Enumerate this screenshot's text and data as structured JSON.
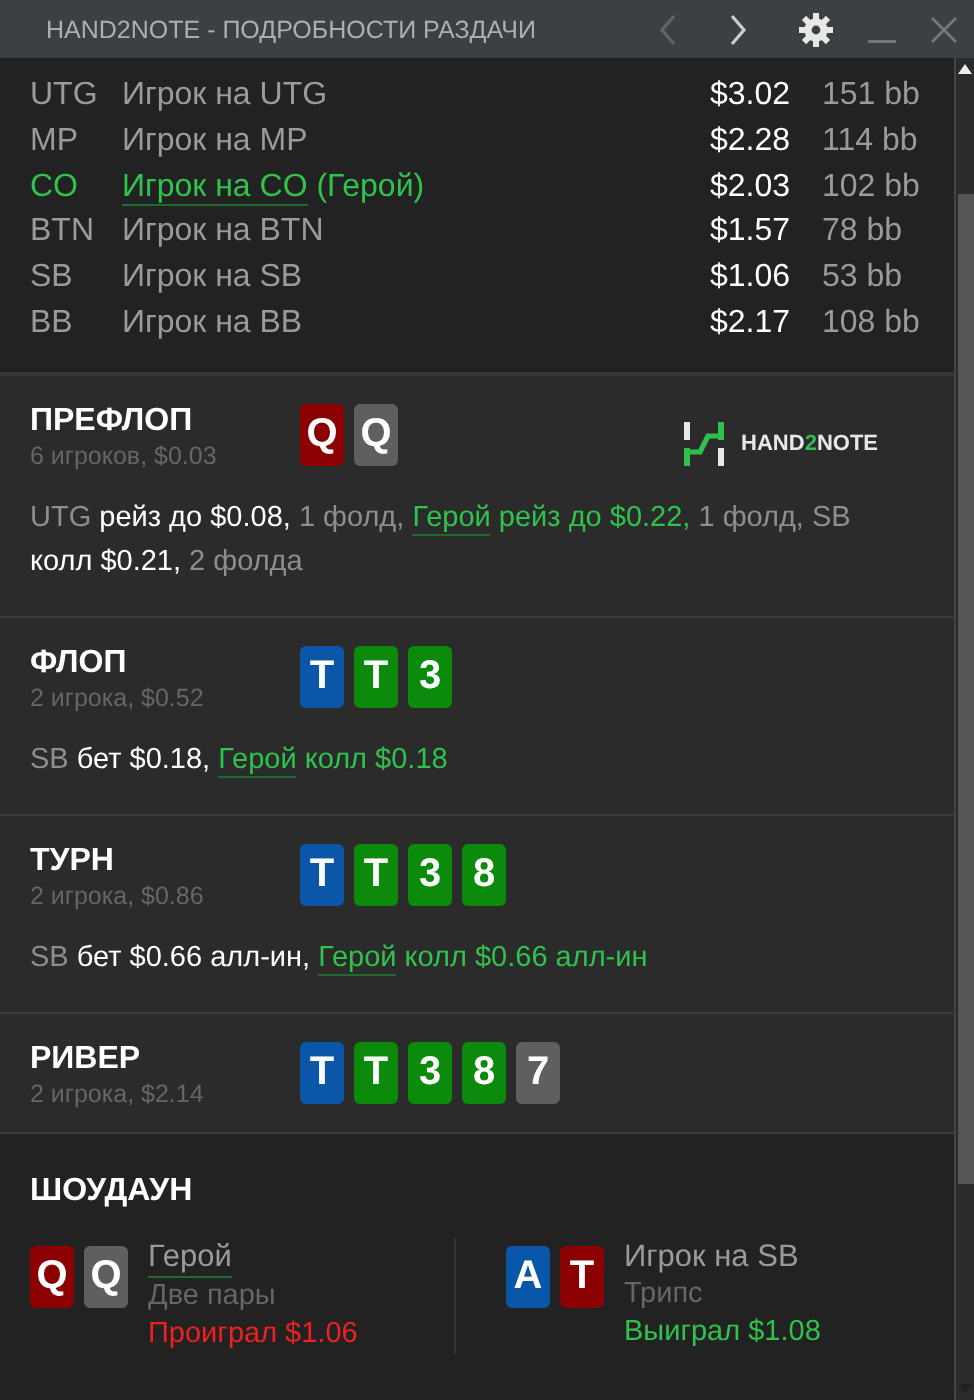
{
  "window": {
    "title": "HAND2NOTE - ПОДРОБНОСТИ РАЗДАЧИ",
    "prev_disabled": true,
    "next_disabled": false
  },
  "players": [
    {
      "position": "UTG",
      "name": "Игрок на UTG",
      "hero": false,
      "stack": "$3.02",
      "bb": "151 bb"
    },
    {
      "position": "MP",
      "name": "Игрок на MP",
      "hero": false,
      "stack": "$2.28",
      "bb": "114 bb"
    },
    {
      "position": "CO",
      "name": "Игрок на CO",
      "suffix": " (Герой)",
      "hero": true,
      "stack": "$2.03",
      "bb": "102 bb"
    },
    {
      "position": "BTN",
      "name": "Игрок на BTN",
      "hero": false,
      "stack": "$1.57",
      "bb": "78 bb"
    },
    {
      "position": "SB",
      "name": "Игрок на SB",
      "hero": false,
      "stack": "$1.06",
      "bb": "53 bb"
    },
    {
      "position": "BB",
      "name": "Игрок на BB",
      "hero": false,
      "stack": "$2.17",
      "bb": "108 bb"
    }
  ],
  "logo": [
    {
      "text": "HAND",
      "accent": false
    },
    {
      "text": "2",
      "accent": true
    },
    {
      "text": "NOTE",
      "accent": false
    }
  ],
  "streets": [
    {
      "title": "ПРЕФЛОП",
      "subtitle": "6 игроков, $0.03",
      "show_logo": true,
      "cards": [
        {
          "rank": "Q",
          "color": "#8b0000"
        },
        {
          "rank": "Q",
          "color": "#5f5f5f"
        }
      ],
      "actions": [
        {
          "kind": "pos",
          "text": "UTG "
        },
        {
          "kind": "act",
          "text": "рейз до $0.08, "
        },
        {
          "kind": "fold",
          "text": "1 фолд, "
        },
        {
          "kind": "hero",
          "text": "Герой"
        },
        {
          "kind": "hero_act",
          "text": " рейз до $0.22, "
        },
        {
          "kind": "fold",
          "text": "1 фолд, "
        },
        {
          "kind": "pos",
          "text": "SB "
        },
        {
          "kind": "act",
          "text": "колл $0.21, "
        },
        {
          "kind": "fold",
          "text": "2 фолда"
        }
      ]
    },
    {
      "title": "ФЛОП",
      "subtitle": "2 игрока, $0.52",
      "show_logo": false,
      "cards": [
        {
          "rank": "T",
          "color": "#0a56a8"
        },
        {
          "rank": "T",
          "color": "#0b8a0b"
        },
        {
          "rank": "3",
          "color": "#0b8a0b"
        }
      ],
      "actions": [
        {
          "kind": "pos",
          "text": "SB "
        },
        {
          "kind": "act",
          "text": "бет $0.18, "
        },
        {
          "kind": "hero",
          "text": "Герой"
        },
        {
          "kind": "hero_act",
          "text": " колл $0.18"
        }
      ]
    },
    {
      "title": "ТУРН",
      "subtitle": "2 игрока, $0.86",
      "show_logo": false,
      "cards": [
        {
          "rank": "T",
          "color": "#0a56a8"
        },
        {
          "rank": "T",
          "color": "#0b8a0b"
        },
        {
          "rank": "3",
          "color": "#0b8a0b"
        },
        {
          "rank": "8",
          "color": "#0b8a0b"
        }
      ],
      "actions": [
        {
          "kind": "pos",
          "text": "SB "
        },
        {
          "kind": "act",
          "text": "бет $0.66 алл-ин, "
        },
        {
          "kind": "hero",
          "text": "Герой"
        },
        {
          "kind": "hero_act",
          "text": " колл $0.66 алл-ин"
        }
      ]
    },
    {
      "title": "РИВЕР",
      "subtitle": "2 игрока, $2.14",
      "show_logo": false,
      "cards": [
        {
          "rank": "T",
          "color": "#0a56a8"
        },
        {
          "rank": "T",
          "color": "#0b8a0b"
        },
        {
          "rank": "3",
          "color": "#0b8a0b"
        },
        {
          "rank": "8",
          "color": "#0b8a0b"
        },
        {
          "rank": "7",
          "color": "#5f5f5f"
        }
      ]
    }
  ],
  "showdown": {
    "title": "ШОУДАУН",
    "hands": [
      {
        "name": "Герой",
        "hero": true,
        "hand": "Две пары",
        "result": "Проиграл $1.06",
        "won": false,
        "cards": [
          {
            "rank": "Q",
            "color": "#8b0000"
          },
          {
            "rank": "Q",
            "color": "#5f5f5f"
          }
        ]
      },
      {
        "name": "Игрок на SB",
        "hero": false,
        "hand": "Трипс",
        "result": "Выиграл $1.08",
        "won": true,
        "cards": [
          {
            "rank": "A",
            "color": "#0a56a8"
          },
          {
            "rank": "T",
            "color": "#8b0000"
          }
        ]
      }
    ]
  }
}
